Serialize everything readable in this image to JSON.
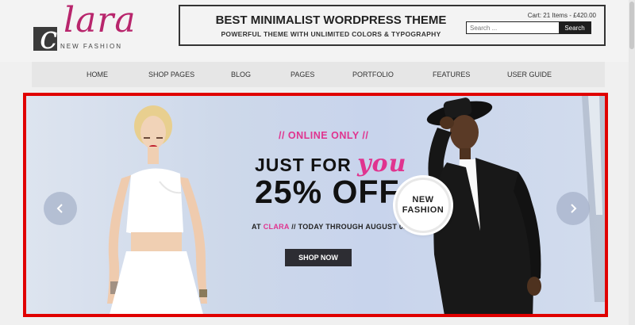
{
  "logo": {
    "mark": "c",
    "word": "lara",
    "tagline": "NEW FASHION"
  },
  "promo": {
    "title": "BEST MINIMALIST WORDPRESS THEME",
    "subtitle": "POWERFUL THEME WITH UNLIMITED COLORS & TYPOGRAPHY"
  },
  "cart": {
    "text": "Cart: 21 Items - £420.00"
  },
  "search": {
    "placeholder": "Search ...",
    "button_label": "Search"
  },
  "nav": {
    "items": [
      {
        "label": "HOME"
      },
      {
        "label": "SHOP PAGES"
      },
      {
        "label": "BLOG"
      },
      {
        "label": "PAGES"
      },
      {
        "label": "PORTFOLIO"
      },
      {
        "label": "FEATURES"
      },
      {
        "label": "USER GUIDE"
      }
    ]
  },
  "slide": {
    "tag": "// ONLINE ONLY //",
    "headline_prefix": "JUST FOR ",
    "headline_accent": "you",
    "discount": "25% OFF",
    "date_prefix": "AT ",
    "date_brand": "CLARA",
    "date_suffix": " // TODAY THROUGH AUGUST 02",
    "cta_label": "SHOP NOW",
    "badge_line1": "NEW",
    "badge_line2": "FASHION"
  },
  "colors": {
    "accent": "#e0348f",
    "brand": "#b8256c",
    "frame": "#e00000"
  },
  "icons": {
    "prev": "chevron-left-icon",
    "next": "chevron-right-icon"
  }
}
